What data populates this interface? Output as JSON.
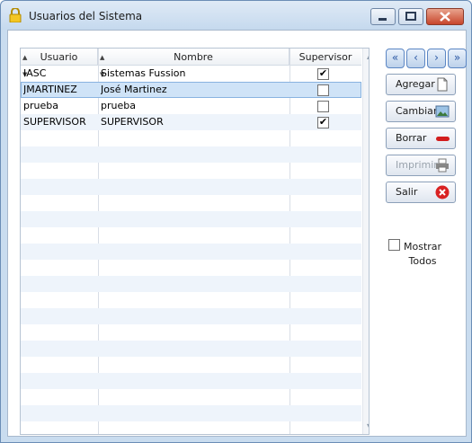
{
  "window": {
    "title": "Usuarios del Sistema"
  },
  "grid": {
    "columns": [
      "Usuario",
      "Nombre",
      "Supervisor"
    ],
    "rows": [
      {
        "usuario": "IASC",
        "nombre": "Sistemas Fussion",
        "supervisor": true
      },
      {
        "usuario": "JMARTINEZ",
        "nombre": "José Martinez",
        "supervisor": false
      },
      {
        "usuario": "prueba",
        "nombre": "prueba",
        "supervisor": false
      },
      {
        "usuario": "SUPERVISOR",
        "nombre": "SUPERVISOR",
        "supervisor": true
      }
    ],
    "selected_row_index": 1
  },
  "nav": {
    "first": "«",
    "prev": "‹",
    "next": "›",
    "last": "»"
  },
  "actions": {
    "agregar": "Agregar",
    "cambiar": "Cambiar",
    "borrar": "Borrar",
    "imprimir": "Imprimir",
    "salir": "Salir"
  },
  "show_all": {
    "line1": "Mostrar",
    "line2": "Todos",
    "checked": false
  },
  "icons": {
    "title": "lock-icon",
    "agregar": "new-document-icon",
    "cambiar": "picture-icon",
    "borrar": "remove-icon",
    "imprimir": "printer-icon",
    "salir": "close-circle-icon"
  },
  "colors": {
    "accent": "#2d5aa5",
    "danger": "#d21d1d",
    "selected_row": "#cfe3f7"
  }
}
